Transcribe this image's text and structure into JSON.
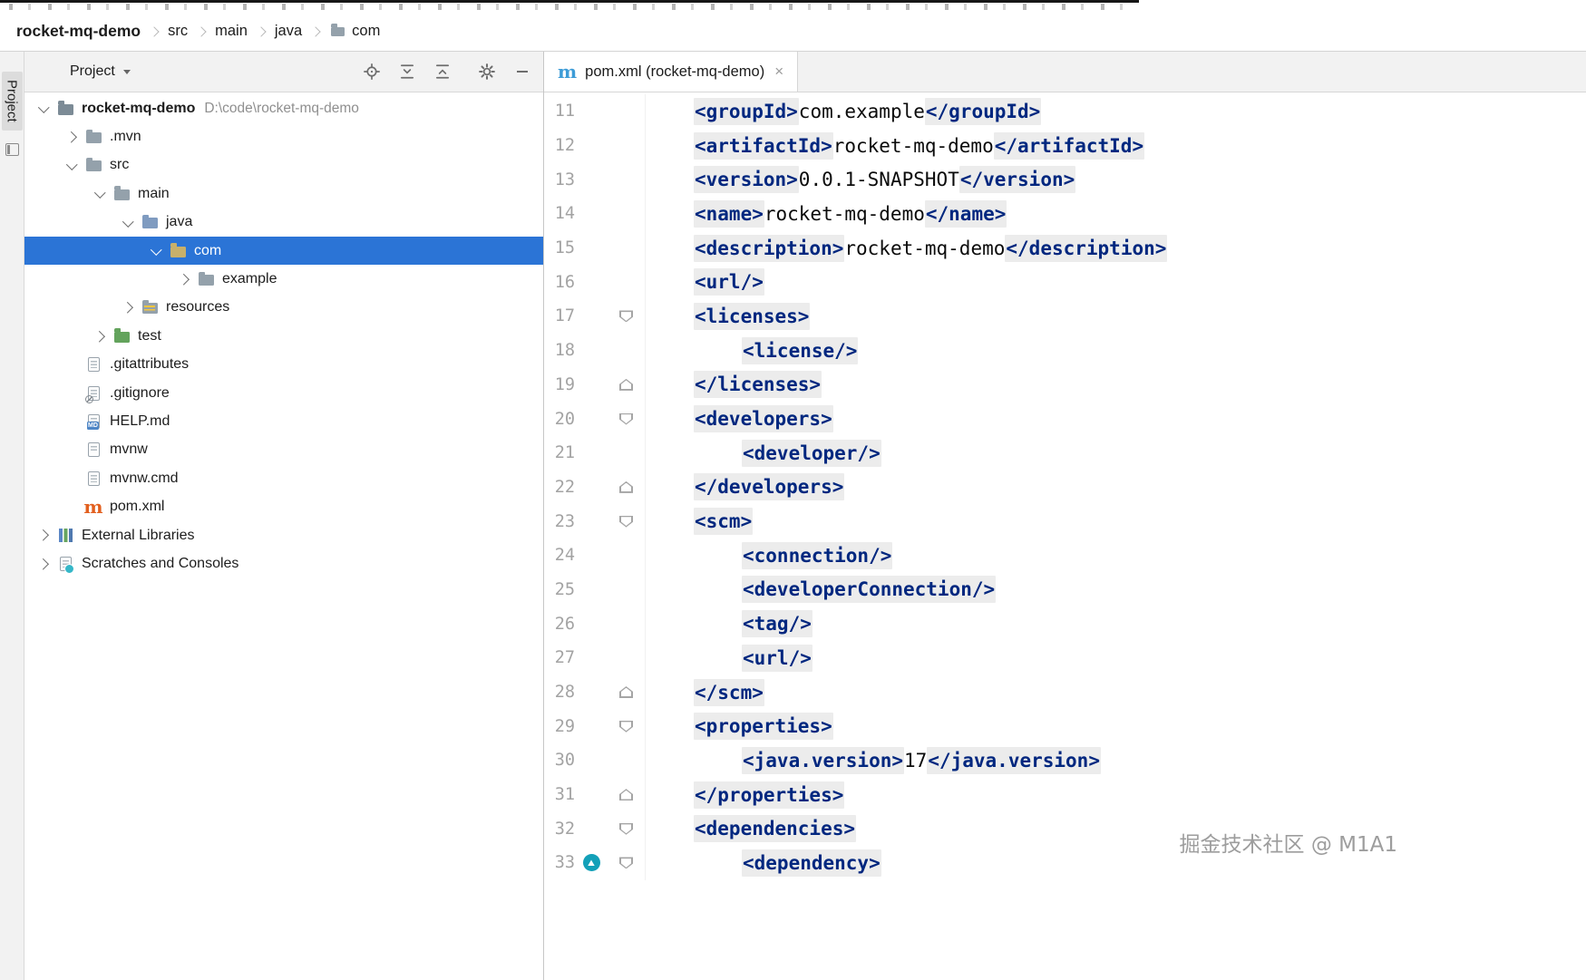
{
  "colors": {
    "selection_blue": "#2b74d6",
    "tag_navy": "#00277f",
    "tag_bg": "#ececec",
    "maven_orange": "#e2601f",
    "maven_blue": "#3d9cd7",
    "watermark_gray": "#9d9d9d"
  },
  "breadcrumb": {
    "items": [
      "rocket-mq-demo",
      "src",
      "main",
      "java",
      "com"
    ]
  },
  "tool_stripe": {
    "project_label": "Project"
  },
  "project_panel": {
    "title": "Project",
    "toolbar_icons": [
      "locate-file-icon",
      "expand-all-icon",
      "collapse-all-icon",
      "settings-gear-icon",
      "hide-panel-icon"
    ],
    "tree": [
      {
        "label": "rocket-mq-demo",
        "hint": "D:\\code\\rocket-mq-demo",
        "indent": 0,
        "chevron": "down",
        "icon": "project-folder",
        "bold": true
      },
      {
        "label": ".mvn",
        "indent": 1,
        "chevron": "right",
        "icon": "folder"
      },
      {
        "label": "src",
        "indent": 1,
        "chevron": "down",
        "icon": "folder"
      },
      {
        "label": "main",
        "indent": 2,
        "chevron": "down",
        "icon": "folder"
      },
      {
        "label": "java",
        "indent": 3,
        "chevron": "down",
        "icon": "folder-source"
      },
      {
        "label": "com",
        "indent": 4,
        "chevron": "down",
        "icon": "folder",
        "selected": true
      },
      {
        "label": "example",
        "indent": 5,
        "chevron": "right",
        "icon": "folder"
      },
      {
        "label": "resources",
        "indent": 3,
        "chevron": "right",
        "icon": "folder-resources"
      },
      {
        "label": "test",
        "indent": 2,
        "chevron": "right",
        "icon": "folder-test"
      },
      {
        "label": ".gitattributes",
        "indent": 1,
        "icon": "file-text"
      },
      {
        "label": ".gitignore",
        "indent": 1,
        "icon": "file-ignore"
      },
      {
        "label": "HELP.md",
        "indent": 1,
        "icon": "file-md"
      },
      {
        "label": "mvnw",
        "indent": 1,
        "icon": "file-plain"
      },
      {
        "label": "mvnw.cmd",
        "indent": 1,
        "icon": "file-text"
      },
      {
        "label": "pom.xml",
        "indent": 1,
        "icon": "maven"
      },
      {
        "label": "External Libraries",
        "indent": 0,
        "chevron": "right",
        "icon": "libraries"
      },
      {
        "label": "Scratches and Consoles",
        "indent": 0,
        "chevron": "right",
        "icon": "scratches"
      }
    ]
  },
  "editor": {
    "tab": {
      "title": "pom.xml (rocket-mq-demo)",
      "close_label": "×"
    },
    "lines": [
      {
        "num": "11",
        "indent": 1,
        "seg": [
          [
            "tag",
            "<groupId>"
          ],
          [
            "txt",
            "com.example"
          ],
          [
            "tag",
            "</groupId>"
          ]
        ]
      },
      {
        "num": "12",
        "indent": 1,
        "seg": [
          [
            "tag",
            "<artifactId>"
          ],
          [
            "txt",
            "rocket-mq-demo"
          ],
          [
            "tag",
            "</artifactId>"
          ]
        ]
      },
      {
        "num": "13",
        "indent": 1,
        "seg": [
          [
            "tag",
            "<version>"
          ],
          [
            "txt",
            "0.0.1-SNAPSHOT"
          ],
          [
            "tag",
            "</version>"
          ]
        ]
      },
      {
        "num": "14",
        "indent": 1,
        "seg": [
          [
            "tag",
            "<name>"
          ],
          [
            "txt",
            "rocket-mq-demo"
          ],
          [
            "tag",
            "</name>"
          ]
        ]
      },
      {
        "num": "15",
        "indent": 1,
        "seg": [
          [
            "tag",
            "<description>"
          ],
          [
            "txt",
            "rocket-mq-demo"
          ],
          [
            "tag",
            "</description>"
          ]
        ]
      },
      {
        "num": "16",
        "indent": 1,
        "seg": [
          [
            "tag",
            "<url/>"
          ]
        ]
      },
      {
        "num": "17",
        "indent": 1,
        "fold": "start",
        "seg": [
          [
            "tag",
            "<licenses>"
          ]
        ]
      },
      {
        "num": "18",
        "indent": 2,
        "guide": true,
        "seg": [
          [
            "tag",
            "<license/>"
          ]
        ]
      },
      {
        "num": "19",
        "indent": 1,
        "fold": "end",
        "seg": [
          [
            "tag",
            "</licenses>"
          ]
        ]
      },
      {
        "num": "20",
        "indent": 1,
        "fold": "start",
        "seg": [
          [
            "tag",
            "<developers>"
          ]
        ]
      },
      {
        "num": "21",
        "indent": 2,
        "guide": true,
        "seg": [
          [
            "tag",
            "<developer/>"
          ]
        ]
      },
      {
        "num": "22",
        "indent": 1,
        "fold": "end",
        "seg": [
          [
            "tag",
            "</developers>"
          ]
        ]
      },
      {
        "num": "23",
        "indent": 1,
        "fold": "start",
        "seg": [
          [
            "tag",
            "<scm>"
          ]
        ]
      },
      {
        "num": "24",
        "indent": 2,
        "guide": true,
        "seg": [
          [
            "tag",
            "<connection/>"
          ]
        ]
      },
      {
        "num": "25",
        "indent": 2,
        "guide": true,
        "seg": [
          [
            "tag",
            "<developerConnection/>"
          ]
        ]
      },
      {
        "num": "26",
        "indent": 2,
        "guide": true,
        "seg": [
          [
            "tag",
            "<tag/>"
          ]
        ]
      },
      {
        "num": "27",
        "indent": 2,
        "guide": true,
        "seg": [
          [
            "tag",
            "<url/>"
          ]
        ]
      },
      {
        "num": "28",
        "indent": 1,
        "fold": "end",
        "seg": [
          [
            "tag",
            "</scm>"
          ]
        ]
      },
      {
        "num": "29",
        "indent": 1,
        "fold": "start",
        "seg": [
          [
            "tag",
            "<properties>"
          ]
        ]
      },
      {
        "num": "30",
        "indent": 2,
        "guide": true,
        "seg": [
          [
            "tag",
            "<java.version>"
          ],
          [
            "txt",
            "17"
          ],
          [
            "tag",
            "</java.version>"
          ]
        ]
      },
      {
        "num": "31",
        "indent": 1,
        "fold": "end",
        "seg": [
          [
            "tag",
            "</properties>"
          ]
        ]
      },
      {
        "num": "32",
        "indent": 1,
        "fold": "start",
        "seg": [
          [
            "tag",
            "<dependencies>"
          ]
        ]
      },
      {
        "num": "33",
        "indent": 2,
        "fold": "start",
        "icon": "teal-dot",
        "seg": [
          [
            "tag",
            "<dependency>"
          ]
        ]
      }
    ]
  },
  "watermark": {
    "text": "掘金技术社区 @ M1A1"
  }
}
